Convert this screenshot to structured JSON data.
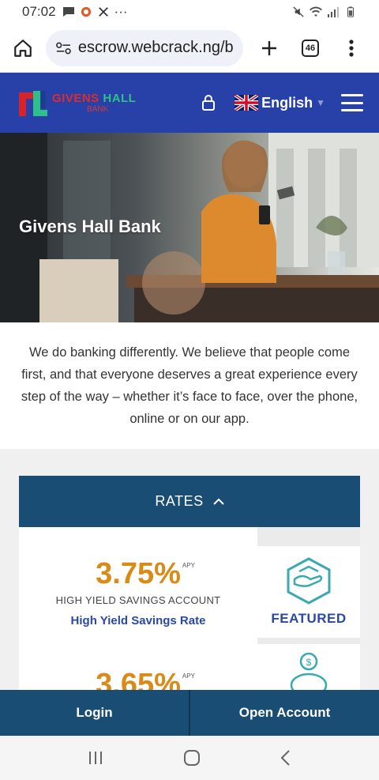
{
  "status_bar": {
    "time": "07:02",
    "more": "···"
  },
  "browser": {
    "url": "escrow.webcrack.ng/ba",
    "tabs_count": "46"
  },
  "header": {
    "logo_line1": "GIVENS",
    "logo_line2": "HALL",
    "logo_sub": "BANK",
    "language": "English",
    "colors": {
      "background": "#2841a8"
    }
  },
  "hero": {
    "title": "Givens Hall Bank"
  },
  "intro": {
    "text": "We do banking differently. We believe that people come first, and that everyone deserves a great experience every step of the way – whether it’s face to face, over the phone, online or on our app."
  },
  "rates": {
    "title": "RATES",
    "items": [
      {
        "value": "3.75%",
        "suffix": "APY",
        "name": "HIGH YIELD SAVINGS ACCOUNT",
        "link": "High Yield Savings Rate",
        "badge": "FEATURED",
        "badge_icon": "hand-box-icon"
      },
      {
        "value": "3.65%",
        "suffix": "APY",
        "badge_icon": "piggy-bank-icon"
      }
    ]
  },
  "bottom_bar": {
    "login": "Login",
    "open_account": "Open Account"
  },
  "colors": {
    "brand_blue": "#2841a8",
    "rates_blue": "#1a4d74",
    "rate_orange": "#d98a17",
    "link_blue": "#2a48a7",
    "teal": "#3aa9b0"
  }
}
